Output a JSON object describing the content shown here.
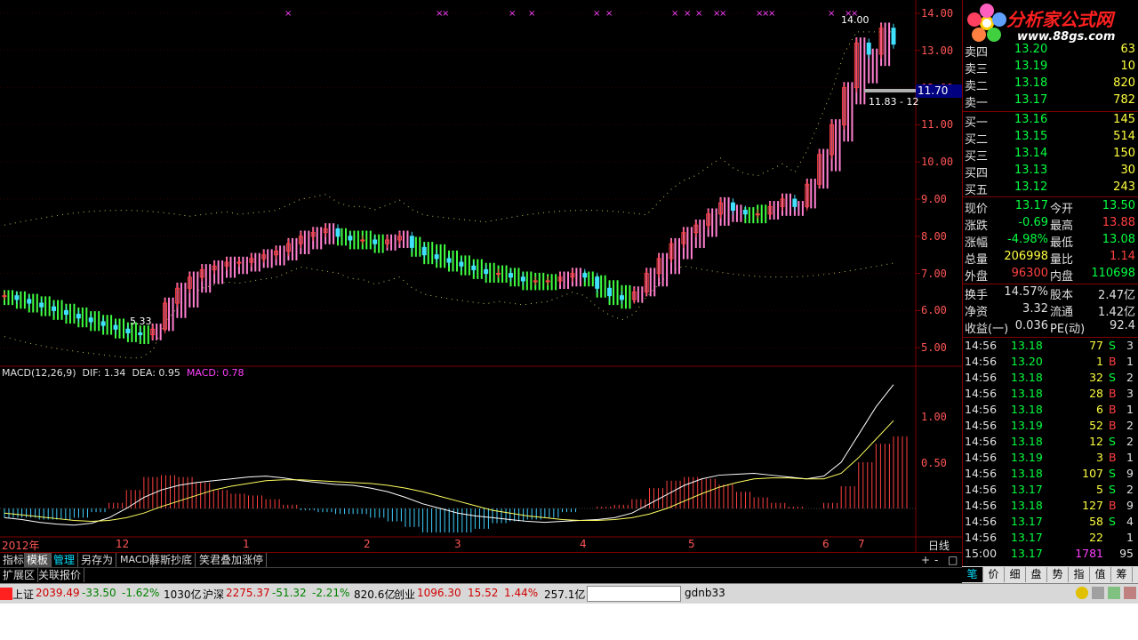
{
  "price_axis": [
    "14.00",
    "13.00",
    "12.00",
    "11.00",
    "10.00",
    "9.00",
    "8.00",
    "7.00",
    "6.00",
    "5.00"
  ],
  "price_marker": "11.70",
  "chart_annotations": {
    "high_label": "14.00",
    "low_label": "5.33",
    "mid_label": "11.83 - 12"
  },
  "macd": {
    "title": "MACD(12,26,9)",
    "dif": "DIF: 1.34",
    "dea": "DEA: 0.95",
    "macd": "MACD: 0.78",
    "axis": [
      "1.00",
      "0.50"
    ]
  },
  "x_axis": [
    "2012年",
    "12",
    "1",
    "2",
    "3",
    "4",
    "5",
    "6",
    "7"
  ],
  "period_label": "日线",
  "tabs": [
    "指标",
    "模板",
    "管理",
    "另存为",
    "MACD",
    "薛斯抄底",
    "笑君叠加涨停"
  ],
  "sub_tabs": [
    "扩展区",
    "关联报价"
  ],
  "zoom_buttons": [
    "+",
    "-",
    "□"
  ],
  "logo": {
    "title": "分析家公式网",
    "url": "www.88gs.com"
  },
  "order_book": {
    "asks": [
      {
        "label": "卖四",
        "price": "13.20",
        "vol": "63"
      },
      {
        "label": "卖三",
        "price": "13.19",
        "vol": "10"
      },
      {
        "label": "卖二",
        "price": "13.18",
        "vol": "820"
      },
      {
        "label": "卖一",
        "price": "13.17",
        "vol": "782"
      }
    ],
    "bids": [
      {
        "label": "买一",
        "price": "13.16",
        "vol": "145"
      },
      {
        "label": "买二",
        "price": "13.15",
        "vol": "514"
      },
      {
        "label": "买三",
        "price": "13.14",
        "vol": "150"
      },
      {
        "label": "买四",
        "price": "13.13",
        "vol": "30"
      },
      {
        "label": "买五",
        "price": "13.12",
        "vol": "243"
      }
    ]
  },
  "quote": [
    {
      "l1": "现价",
      "v1": "13.17",
      "l2": "今开",
      "v2": "13.50"
    },
    {
      "l1": "涨跌",
      "v1": "-0.69",
      "l2": "最高",
      "v2": "13.88"
    },
    {
      "l1": "涨幅",
      "v1": "-4.98%",
      "l2": "最低",
      "v2": "13.08"
    },
    {
      "l1": "总量",
      "v1": "206998",
      "l2": "量比",
      "v2": "1.14"
    },
    {
      "l1": "外盘",
      "v1": "96300",
      "l2": "内盘",
      "v2": "110698"
    }
  ],
  "fundamentals": [
    {
      "l1": "换手",
      "v1": "14.57%",
      "l2": "股本",
      "v2": "2.47亿"
    },
    {
      "l1": "净资",
      "v1": "3.32",
      "l2": "流通",
      "v2": "1.42亿"
    },
    {
      "l1": "收益(一)",
      "v1": "0.036",
      "l2": "PE(动)",
      "v2": "92.4"
    }
  ],
  "trades": [
    {
      "time": "14:56",
      "price": "13.18",
      "vol": "77",
      "side": "S",
      "n": "3"
    },
    {
      "time": "14:56",
      "price": "13.20",
      "vol": "1",
      "side": "B",
      "n": "1"
    },
    {
      "time": "14:56",
      "price": "13.18",
      "vol": "32",
      "side": "S",
      "n": "2"
    },
    {
      "time": "14:56",
      "price": "13.18",
      "vol": "28",
      "side": "B",
      "n": "3"
    },
    {
      "time": "14:56",
      "price": "13.18",
      "vol": "6",
      "side": "B",
      "n": "1"
    },
    {
      "time": "14:56",
      "price": "13.19",
      "vol": "52",
      "side": "B",
      "n": "2"
    },
    {
      "time": "14:56",
      "price": "13.18",
      "vol": "12",
      "side": "S",
      "n": "2"
    },
    {
      "time": "14:56",
      "price": "13.19",
      "vol": "3",
      "side": "B",
      "n": "1"
    },
    {
      "time": "14:56",
      "price": "13.18",
      "vol": "107",
      "side": "S",
      "n": "9"
    },
    {
      "time": "14:56",
      "price": "13.17",
      "vol": "5",
      "side": "S",
      "n": "2"
    },
    {
      "time": "14:56",
      "price": "13.18",
      "vol": "127",
      "side": "B",
      "n": "9"
    },
    {
      "time": "14:56",
      "price": "13.17",
      "vol": "58",
      "side": "S",
      "n": "4"
    },
    {
      "time": "14:56",
      "price": "13.17",
      "vol": "22",
      "side": "",
      "n": "1"
    },
    {
      "time": "15:00",
      "price": "13.17",
      "vol": "1781",
      "side": "",
      "n": "95"
    }
  ],
  "right_tabs": [
    "笔",
    "价",
    "细",
    "盘",
    "势",
    "指",
    "值",
    "筹"
  ],
  "status": {
    "sh_name": "上证",
    "sh_val": "2039.49",
    "sh_chg": "-33.50",
    "sh_pct": "-1.62%",
    "sh_amt": "1030亿",
    "sz_name": "沪深",
    "sz_val": "2275.37",
    "sz_chg": "-51.32",
    "sz_pct": "-2.21%",
    "sz_amt": "820.6亿",
    "cy_name": "创业",
    "cy_val": "1096.30",
    "cy_chg": "15.52",
    "cy_pct": "1.44%",
    "cy_amt": "257.1亿",
    "user": "gdnb33"
  },
  "colors": {
    "up": "#ff4040",
    "down": "#00ff40",
    "ribbon_up": "#ff80d0",
    "ribbon_down": "#40ff40",
    "grid": "#800000"
  },
  "chart_data": {
    "type": "line",
    "title": "",
    "ylim": [
      5.0,
      14.0
    ],
    "macd_ylim": [
      -0.2,
      1.4
    ],
    "candles_close": [
      6.4,
      6.3,
      6.2,
      6.1,
      6.0,
      5.9,
      5.8,
      5.7,
      5.6,
      5.5,
      5.4,
      5.35,
      5.5,
      6.2,
      6.6,
      6.9,
      7.1,
      7.2,
      7.3,
      7.3,
      7.4,
      7.5,
      7.6,
      7.8,
      8.0,
      8.1,
      8.2,
      8.0,
      7.9,
      7.9,
      7.8,
      7.9,
      8.0,
      7.7,
      7.5,
      7.4,
      7.3,
      7.2,
      7.1,
      7.0,
      7.0,
      6.9,
      6.8,
      6.8,
      6.8,
      6.9,
      7.0,
      6.9,
      6.6,
      6.4,
      6.3,
      6.5,
      7.0,
      7.4,
      7.8,
      8.1,
      8.3,
      8.6,
      8.9,
      8.7,
      8.6,
      8.6,
      8.8,
      9.0,
      8.8,
      9.4,
      10.2,
      11.0,
      12.0,
      13.2,
      12.9,
      13.6,
      13.17
    ],
    "macd_dif": [
      -0.1,
      -0.12,
      -0.15,
      -0.17,
      -0.18,
      -0.16,
      -0.1,
      0.0,
      0.12,
      0.2,
      0.25,
      0.28,
      0.3,
      0.32,
      0.34,
      0.35,
      0.33,
      0.3,
      0.28,
      0.26,
      0.25,
      0.22,
      0.18,
      0.12,
      0.05,
      0.0,
      -0.05,
      -0.08,
      -0.1,
      -0.12,
      -0.14,
      -0.15,
      -0.14,
      -0.13,
      -0.12,
      -0.1,
      -0.05,
      0.05,
      0.15,
      0.25,
      0.32,
      0.36,
      0.37,
      0.38,
      0.36,
      0.34,
      0.32,
      0.35,
      0.5,
      0.8,
      1.1,
      1.34
    ],
    "macd_dea": [
      -0.05,
      -0.07,
      -0.09,
      -0.11,
      -0.13,
      -0.14,
      -0.13,
      -0.1,
      -0.05,
      0.02,
      0.08,
      0.14,
      0.2,
      0.24,
      0.27,
      0.3,
      0.31,
      0.31,
      0.3,
      0.29,
      0.28,
      0.27,
      0.25,
      0.22,
      0.18,
      0.13,
      0.08,
      0.03,
      -0.02,
      -0.05,
      -0.08,
      -0.1,
      -0.12,
      -0.13,
      -0.13,
      -0.12,
      -0.1,
      -0.06,
      0.0,
      0.08,
      0.16,
      0.23,
      0.28,
      0.32,
      0.33,
      0.33,
      0.32,
      0.32,
      0.38,
      0.55,
      0.75,
      0.95
    ]
  }
}
